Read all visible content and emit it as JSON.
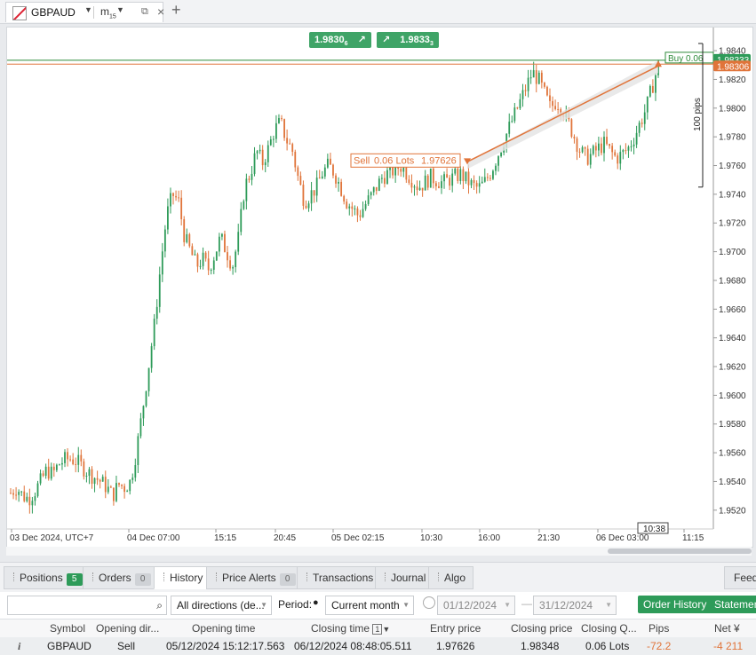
{
  "window": {
    "symbol": "GBPAUD",
    "timeframe": "m",
    "timeframe_sub": "15"
  },
  "chart": {
    "sell_quote": "1.9830",
    "sell_quote_sub": "6",
    "buy_quote": "1.9833",
    "buy_quote_sub": "3",
    "sell_trade_label": "Sell",
    "sell_trade_lots": "0.06 Lots",
    "sell_trade_price": "1.97626",
    "buy_label": "Buy",
    "buy_lots": "0.06",
    "buy_price_tag": "1.98333",
    "bid_price_tag": "1.98306",
    "ruler_label": "100 pips",
    "countdown": "10:38",
    "y_ticks": [
      "1.9840",
      "1.9820",
      "1.9800",
      "1.9780",
      "1.9760",
      "1.9740",
      "1.9720",
      "1.9700",
      "1.9680",
      "1.9660",
      "1.9640",
      "1.9620",
      "1.9600",
      "1.9580",
      "1.9560",
      "1.9540",
      "1.9520"
    ],
    "x_ticks": [
      "03 Dec 2024, UTC+7",
      "04 Dec 07:00",
      "15:15",
      "20:45",
      "05 Dec 02:15",
      "10:30",
      "16:00",
      "21:30",
      "06 Dec 03:00",
      "11:15"
    ],
    "colors": {
      "up": "#2e9b59",
      "down": "#e0743a",
      "buy_line": "#2e8b3a",
      "sell_line": "#e0743a"
    }
  },
  "chart_data": {
    "type": "candlestick",
    "symbol": "GBPAUD",
    "timeframe": "m15",
    "ylim": [
      1.951,
      1.9845
    ],
    "y_ticks": [
      1.984,
      1.982,
      1.98,
      1.978,
      1.976,
      1.974,
      1.972,
      1.97,
      1.968,
      1.966,
      1.964,
      1.962,
      1.96,
      1.958,
      1.956,
      1.954,
      1.952
    ],
    "x_tick_labels": [
      "03 Dec 2024, UTC+7",
      "04 Dec 07:00",
      "15:15",
      "20:45",
      "05 Dec 02:15",
      "10:30",
      "16:00",
      "21:30",
      "06 Dec 03:00",
      "11:15"
    ],
    "close_path": [
      1.9532,
      1.9536,
      1.953,
      1.9528,
      1.9533,
      1.954,
      1.9548,
      1.9545,
      1.9552,
      1.9555,
      1.9556,
      1.9554,
      1.955,
      1.9546,
      1.9543,
      1.954,
      1.9536,
      1.953,
      1.9538,
      1.9536,
      1.954,
      1.9562,
      1.959,
      1.962,
      1.965,
      1.969,
      1.9725,
      1.974,
      1.9735,
      1.971,
      1.97,
      1.969,
      1.9695,
      1.9688,
      1.9698,
      1.971,
      1.97,
      1.969,
      1.971,
      1.9745,
      1.9755,
      1.977,
      1.9762,
      1.9772,
      1.9785,
      1.979,
      1.9778,
      1.977,
      1.975,
      1.9735,
      1.974,
      1.9745,
      1.9755,
      1.976,
      1.9755,
      1.9745,
      1.9735,
      1.973,
      1.9725,
      1.9732,
      1.9738,
      1.9745,
      1.9752,
      1.9755,
      1.9757,
      1.976,
      1.9755,
      1.975,
      1.9745,
      1.9748,
      1.9752,
      1.975,
      1.9748,
      1.975,
      1.9752,
      1.9754,
      1.975,
      1.9746,
      1.9744,
      1.9748,
      1.9755,
      1.9765,
      1.9775,
      1.9785,
      1.9795,
      1.9805,
      1.9815,
      1.9825,
      1.982,
      1.981,
      1.98,
      1.9805,
      1.98,
      1.979,
      1.978,
      1.977,
      1.9765,
      1.9768,
      1.9772,
      1.9775,
      1.977,
      1.9765,
      1.9768,
      1.9772,
      1.978,
      1.979,
      1.98,
      1.9815,
      1.983
    ],
    "positions": [
      {
        "side": "Sell",
        "lots": 0.06,
        "entry": 1.97626
      },
      {
        "side": "Buy",
        "lots": 0.06,
        "price": 1.98333
      }
    ],
    "current_bid": 1.98306,
    "current_ask": 1.98333,
    "ruler_pips": 100
  },
  "bottom_panel": {
    "tabs": [
      {
        "label": "Positions",
        "badge": "5"
      },
      {
        "label": "Orders",
        "badge": "0"
      },
      {
        "label": "History",
        "badge": ""
      },
      {
        "label": "Price Alerts",
        "badge": "0"
      },
      {
        "label": "Transactions",
        "badge": ""
      },
      {
        "label": "Journal",
        "badge": ""
      },
      {
        "label": "Algo",
        "badge": ""
      }
    ],
    "feedback_label": "Feedb",
    "filters": {
      "search_value": "",
      "direction": "All directions (de...",
      "period_label": "Period:",
      "period_value": "Current month",
      "date_from": "01/12/2024",
      "date_to": "31/12/2024",
      "order_history_label": "Order History",
      "statement_label": "Statemen"
    },
    "columns": [
      "Symbol",
      "Opening dir...",
      "Opening time",
      "Closing time",
      "Entry price",
      "Closing price",
      "Closing Q...",
      "Pips",
      "Net ¥"
    ],
    "sort_index": "1",
    "rows": [
      {
        "icon": "i",
        "symbol": "GBPAUD",
        "direction": "Sell",
        "opening_time": "05/12/2024 15:12:17.563",
        "closing_time": "06/12/2024 08:48:05.511",
        "entry_price": "1.97626",
        "closing_price": "1.98348",
        "closing_qty": "0.06 Lots",
        "pips": "-72.2",
        "net": "-4 211"
      }
    ]
  }
}
